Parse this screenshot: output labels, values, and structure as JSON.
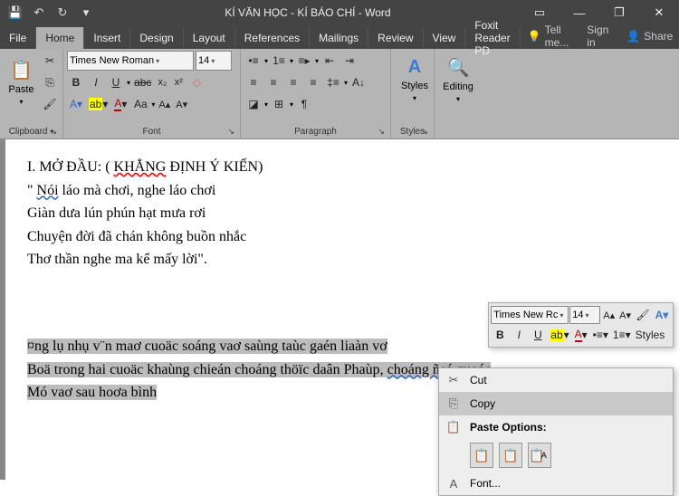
{
  "title": "KÍ VĂN HỌC - KÍ BÁO CHÍ  - Word",
  "qat": {
    "save": "💾",
    "undo": "↶",
    "redo": "↻"
  },
  "wincontrols": {
    "ribbonopt": "▭",
    "min": "—",
    "restore": "❐",
    "close": "✕"
  },
  "tabs": {
    "file": "File",
    "home": "Home",
    "insert": "Insert",
    "design": "Design",
    "layout": "Layout",
    "references": "References",
    "mailings": "Mailings",
    "review": "Review",
    "view": "View",
    "foxit": "Foxit Reader PD"
  },
  "rightmenu": {
    "tell": "Tell me...",
    "signin": "Sign in",
    "share": "Share"
  },
  "ribbon": {
    "clipboard": {
      "label": "Clipboard",
      "paste": "Paste",
      "cut": "✂",
      "copy": "⎘",
      "painter": "🖌"
    },
    "font": {
      "label": "Font",
      "name": "Times New Roman",
      "size": "14",
      "bold": "B",
      "italic": "I",
      "underline": "U",
      "strike": "abc",
      "sub": "x₂",
      "sup": "x²",
      "clear": "◇",
      "effects": "A▾",
      "highlight": "ab",
      "fontcolor": "A",
      "case": "Aa",
      "grow": "A▴",
      "shrink": "A▾"
    },
    "paragraph": {
      "label": "Paragraph",
      "bullets": "•≡",
      "numbers": "1≡",
      "multilevel": "≡▸",
      "dedent": "⇤",
      "indent": "⇥",
      "sort": "A↓",
      "marks": "¶",
      "al": "≡",
      "ac": "≡",
      "ar": "≡",
      "aj": "≡",
      "spacing": "‡≡",
      "shade": "◪",
      "borders": "⊞"
    },
    "styles": {
      "label": "Styles",
      "btn": "Styles",
      "glyph": "A"
    },
    "editing": {
      "label": "Editing",
      "btn": "Editing"
    }
  },
  "doc": {
    "l1a": "I. MỞ ĐẦU: ( ",
    "l1b": "KHẲNG",
    "l1c": " ĐỊNH Ý KIẾN)",
    "l2a": "\" ",
    "l2b": "Nói",
    "l2c": " láo mà chơi, nghe láo chơi",
    "l3": "Giàn dưa lún phún hạt mưa rơi",
    "l4": "Chuyện đời đã chán không buồn nhắc",
    "l5": "Thơ thần nghe ma kể mấy lời\".",
    "l6": "¤ng lụ nhụ v¨n maơ cuoäc soáng vaơ saùng taùc gaén liaàn vơ",
    "l7a": "Boä trong hai cuoäc khaùng chieán choáng thöïc daân Phaùp, ",
    "l7b": "choáng ñeá quoác",
    "l8": "Mó vaơ sau hoơa bình "
  },
  "mini": {
    "font": "Times New Rc",
    "size": "14",
    "styles": "Styles"
  },
  "ctx": {
    "cut": "Cut",
    "copy": "Copy",
    "pasteopt": "Paste Options:",
    "font": "Font..."
  }
}
